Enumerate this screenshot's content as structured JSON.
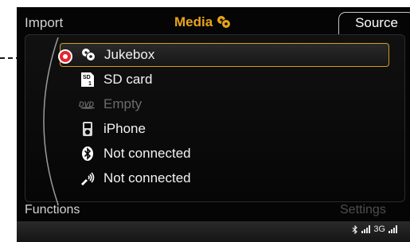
{
  "topbar": {
    "import_label": "Import",
    "media_title": "Media",
    "source_label": "Source"
  },
  "sources": [
    {
      "label": "Jukebox",
      "icon": "jukebox-icon",
      "state": "selected"
    },
    {
      "label": "SD card",
      "icon": "sd-card-icon",
      "state": "normal"
    },
    {
      "label": "Empty",
      "icon": "dvd-icon",
      "state": "disabled"
    },
    {
      "label": "iPhone",
      "icon": "ipod-icon",
      "state": "normal"
    },
    {
      "label": "Not connected",
      "icon": "bluetooth-icon",
      "state": "normal"
    },
    {
      "label": "Not connected",
      "icon": "wireless-audio-icon",
      "state": "normal"
    }
  ],
  "bottom": {
    "functions_label": "Functions",
    "settings_label": "Settings"
  },
  "status": {
    "network_label": "3G"
  },
  "colors": {
    "accent": "#e8a41a",
    "selection_border": "#d49b21",
    "pin": "#e3262f"
  }
}
